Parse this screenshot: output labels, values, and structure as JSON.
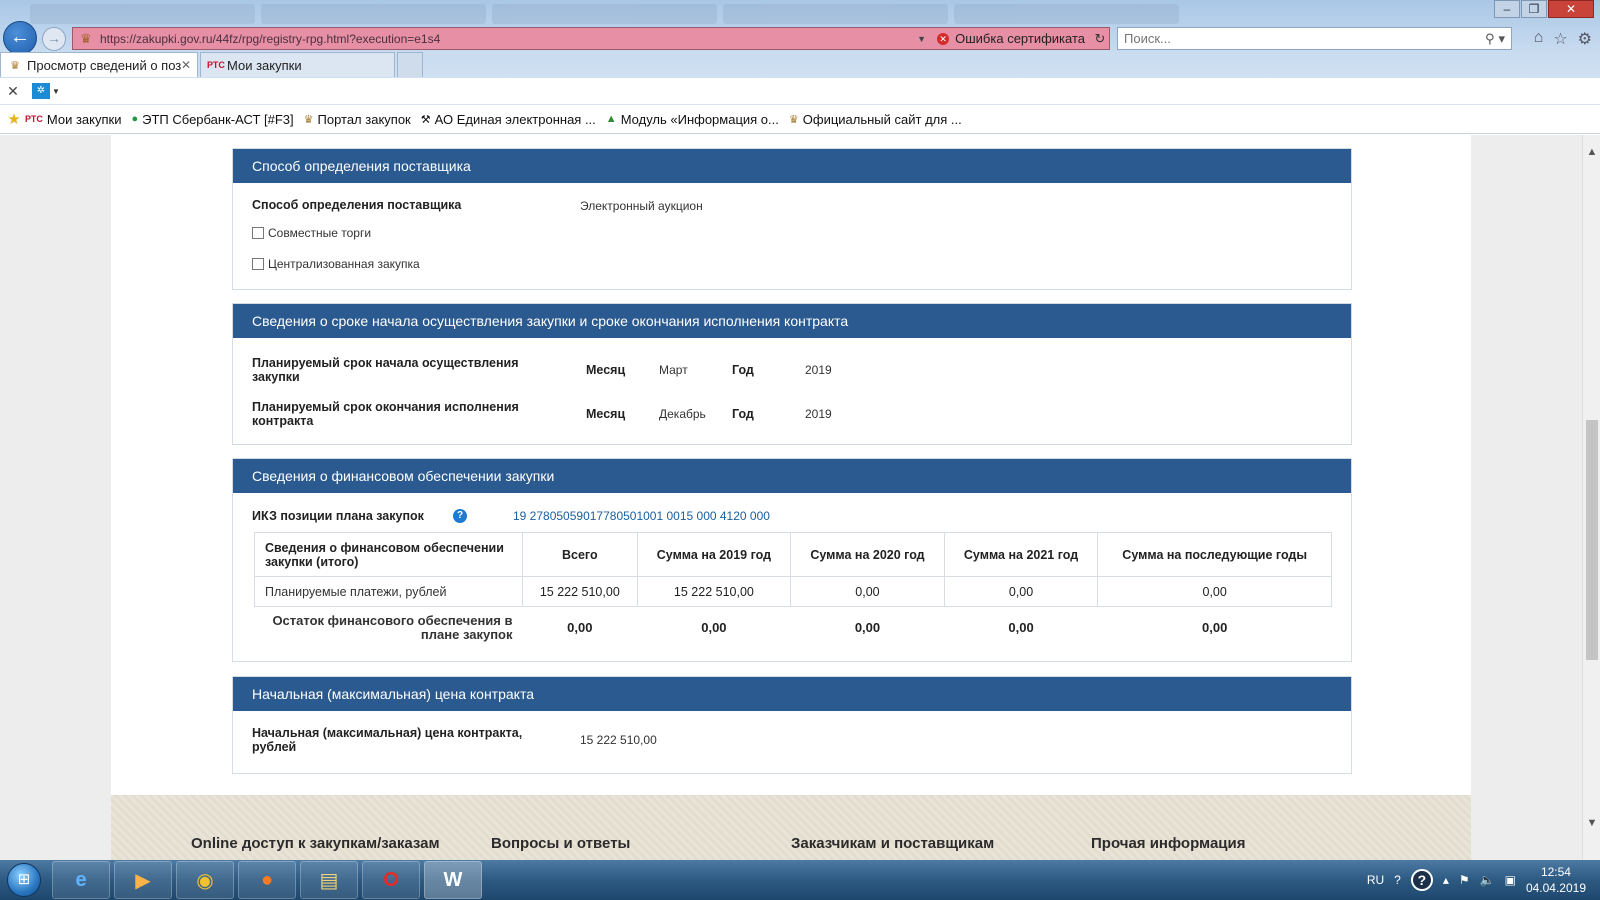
{
  "browser": {
    "url": "https://zakupki.gov.ru/44fz/rpg/registry-rpg.html?execution=e1s4",
    "cert_error": "Ошибка сертификата",
    "search_placeholder": "Поиск...",
    "tabs": [
      {
        "label": "Просмотр сведений о поз..."
      },
      {
        "label": "Мои закупки"
      }
    ],
    "favorites": [
      {
        "label": "Мои закупки",
        "icon": "rts-icon"
      },
      {
        "label": "ЭТП Сбербанк-АСТ [#F3]",
        "icon": "sberbank-icon"
      },
      {
        "label": "Портал закупок",
        "icon": "eagle-icon"
      },
      {
        "label": "АО Единая электронная ...",
        "icon": "hammer-icon"
      },
      {
        "label": "Модуль «Информация о...",
        "icon": "triangle-icon"
      },
      {
        "label": "Официальный сайт для ...",
        "icon": "eagle-icon"
      }
    ]
  },
  "sections": {
    "supplier": {
      "title": "Способ определения поставщика",
      "label": "Способ определения поставщика",
      "value": "Электронный аукцион",
      "joint_trades": "Совместные торги",
      "centralized": "Централизованная закупка"
    },
    "terms": {
      "title": "Сведения о сроке начала осуществления закупки и сроке окончания исполнения контракта",
      "rows": [
        {
          "label": "Планируемый срок начала осуществления закупки",
          "month_label": "Месяц",
          "month": "Март",
          "year_label": "Год",
          "year": "2019"
        },
        {
          "label": "Планируемый срок окончания исполнения контракта",
          "month_label": "Месяц",
          "month": "Декабрь",
          "year_label": "Год",
          "year": "2019"
        }
      ]
    },
    "finance": {
      "title": "Сведения о финансовом обеспечении закупки",
      "ikz_label": "ИКЗ позиции плана закупок",
      "ikz_value": "19 27805059017780501001 0015 000 4120 000",
      "table": {
        "headers": [
          "Сведения о финансовом обеспечении закупки (итого)",
          "Всего",
          "Сумма на 2019 год",
          "Сумма на 2020 год",
          "Сумма на 2021 год",
          "Сумма на последующие годы"
        ],
        "rows": [
          [
            "Планируемые платежи, рублей",
            "15 222 510,00",
            "15 222 510,00",
            "0,00",
            "0,00",
            "0,00"
          ]
        ],
        "total": [
          "Остаток финансового обеспечения в плане закупок",
          "0,00",
          "0,00",
          "0,00",
          "0,00",
          "0,00"
        ]
      }
    },
    "price": {
      "title": "Начальная (максимальная) цена контракта",
      "label": "Начальная (максимальная) цена контракта, рублей",
      "value": "15 222 510,00"
    }
  },
  "footer": {
    "links": [
      "Online доступ к закупкам/заказам",
      "Вопросы и ответы",
      "Заказчикам и поставщикам",
      "Прочая информация"
    ]
  },
  "taskbar": {
    "apps": [
      "explorer-icon",
      "media-player-icon",
      "chrome-icon",
      "firefox-icon",
      "files-icon",
      "opera-icon",
      "word-icon"
    ],
    "lang": "RU",
    "time": "12:54",
    "date": "04.04.2019"
  },
  "colors": {
    "section_header": "#2a5a8f",
    "address_bar_error": "#e78fa4",
    "link": "#1b5e9e"
  }
}
